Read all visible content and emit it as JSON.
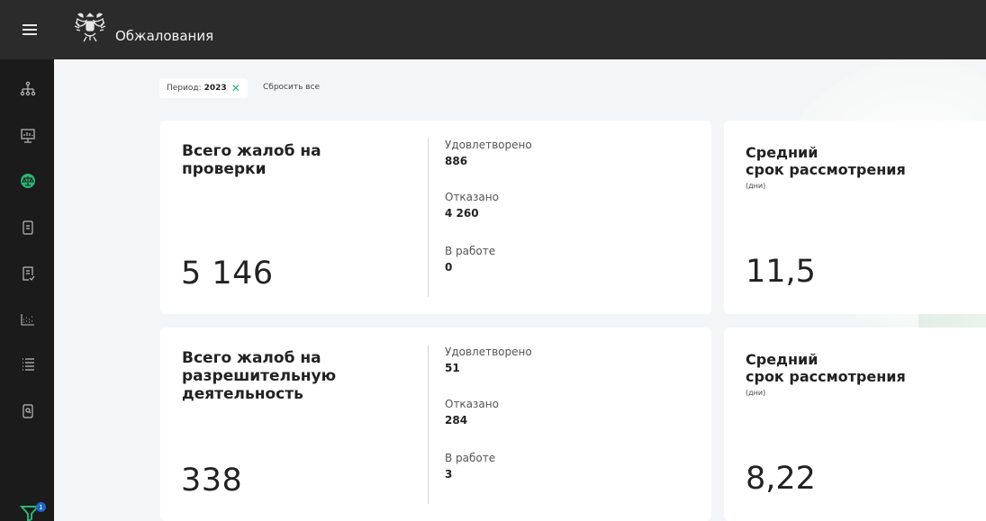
{
  "header": {
    "title": "Обжалования"
  },
  "filters": {
    "period_label": "Период:",
    "period_value": "2023",
    "reset_label": "Сбросить все",
    "badge_count": "1"
  },
  "sidebar": {
    "items": [
      {
        "icon": "structure-icon"
      },
      {
        "icon": "monitor-chart-icon"
      },
      {
        "icon": "scales-icon",
        "active": true
      },
      {
        "icon": "document-icon"
      },
      {
        "icon": "document-check-icon"
      },
      {
        "icon": "dot-chart-icon"
      },
      {
        "icon": "list-icon"
      },
      {
        "icon": "document-search-icon"
      }
    ],
    "filter_icon": "filter-icon"
  },
  "cards": [
    {
      "title_line1": "Всего жалоб на",
      "title_line2": "проверки",
      "title_line3": "",
      "total": "5 146",
      "stats": [
        {
          "label": "Удовлетворено",
          "value": "886"
        },
        {
          "label": "Отказано",
          "value": "4 260"
        },
        {
          "label": "В работе",
          "value": "0"
        }
      ],
      "avg_title_line1": "Средний",
      "avg_title_line2": "срок рассмотрения",
      "avg_unit": "(дни)",
      "avg_value": "11,5"
    },
    {
      "title_line1": "Всего жалоб на",
      "title_line2": "разрешительную",
      "title_line3": "деятельность",
      "total": "338",
      "stats": [
        {
          "label": "Удовлетворено",
          "value": "51"
        },
        {
          "label": "Отказано",
          "value": "284"
        },
        {
          "label": "В работе",
          "value": "3"
        }
      ],
      "avg_title_line1": "Средний",
      "avg_title_line2": "срок рассмотрения",
      "avg_unit": "(дни)",
      "avg_value": "8,22"
    }
  ],
  "colors": {
    "topbar": "#2b2b2b",
    "sidebar": "#1b1b1b",
    "accent_green": "#2bb673",
    "badge_blue": "#1f67c6"
  }
}
